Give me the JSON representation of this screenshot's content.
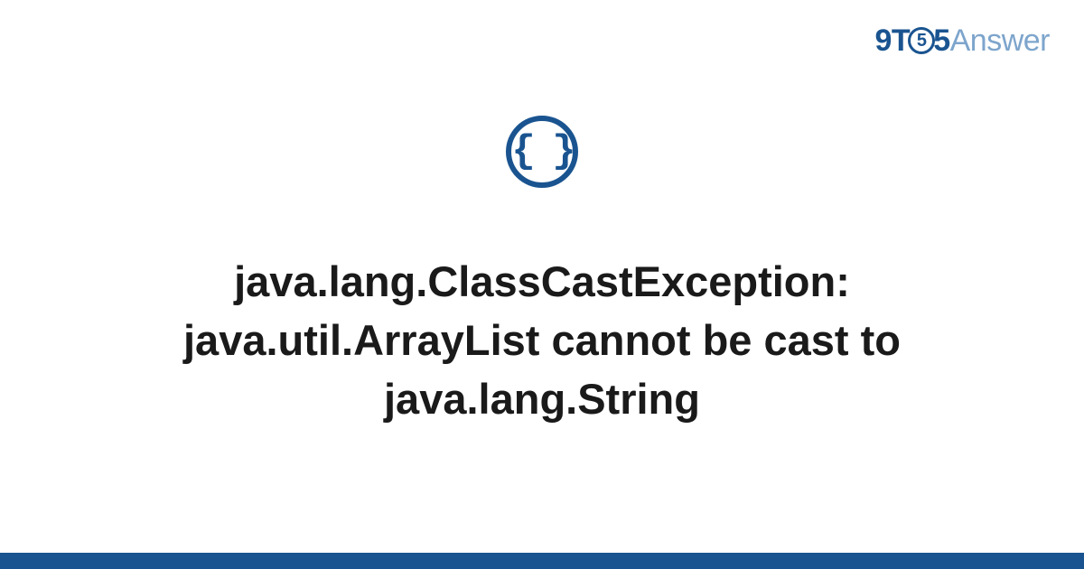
{
  "logo": {
    "part1": "9T",
    "clock": "5",
    "part2": "5",
    "part3": "Answer"
  },
  "icon": {
    "name": "code-braces-icon",
    "glyph": "{ }"
  },
  "title": "java.lang.ClassCastException: java.util.ArrayList cannot be cast to java.lang.String",
  "colors": {
    "brand": "#1a5490",
    "brandLight": "#7da5cc",
    "text": "#1a1a1a"
  }
}
